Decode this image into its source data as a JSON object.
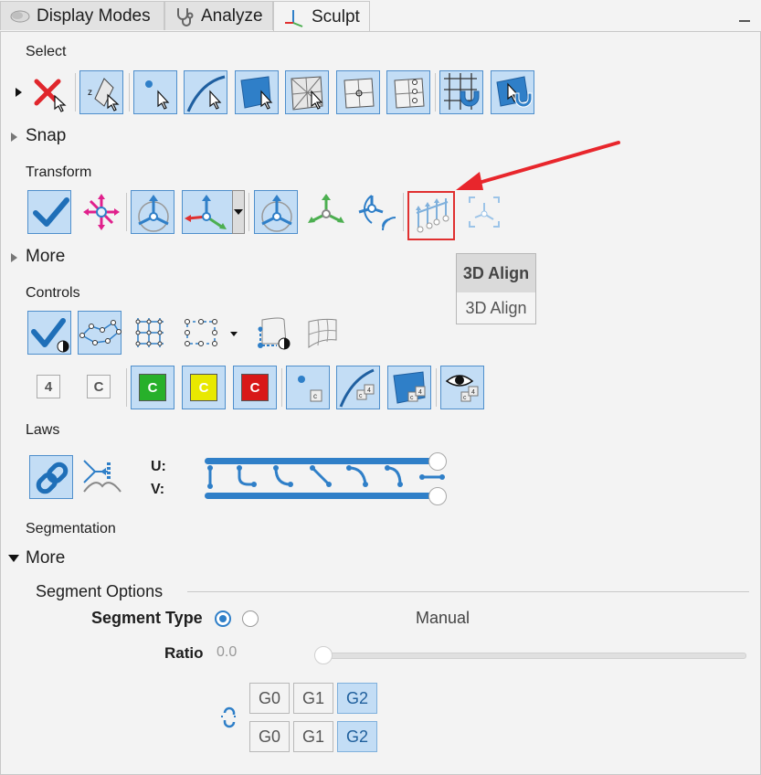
{
  "tabs": [
    {
      "label": "Display Modes",
      "icon": "display-modes-icon",
      "active": false
    },
    {
      "label": "Analyze",
      "icon": "stethoscope-icon",
      "active": false
    },
    {
      "label": "Sculpt",
      "icon": "axes-icon",
      "active": true
    }
  ],
  "sections": {
    "select": "Select",
    "snap": "Snap",
    "transform": "Transform",
    "more1": "More",
    "controls": "Controls",
    "laws": "Laws",
    "segmentation": "Segmentation",
    "more2": "More"
  },
  "tooltip": {
    "title": "3D Align",
    "body": "3D Align"
  },
  "controls": {
    "badge_4": "4",
    "badge_c": "C",
    "green_c": "C",
    "yellow_c": "C",
    "red_c": "C"
  },
  "laws": {
    "u_label": "U:",
    "v_label": "V:"
  },
  "segment_options": {
    "title": "Segment Options",
    "segment_type_label": "Segment Type",
    "manual_label": "Manual",
    "ratio_label": "Ratio",
    "ratio_value": "0.0",
    "ratio_slider_value": 0.0,
    "row1": [
      "G0",
      "G1",
      "G2"
    ],
    "row2": [
      "G0",
      "G1",
      "G2"
    ],
    "selected": "G2"
  },
  "colors": {
    "accent": "#2f7fc8",
    "highlight_box": "#e03030",
    "arrow": "#e8262c"
  }
}
